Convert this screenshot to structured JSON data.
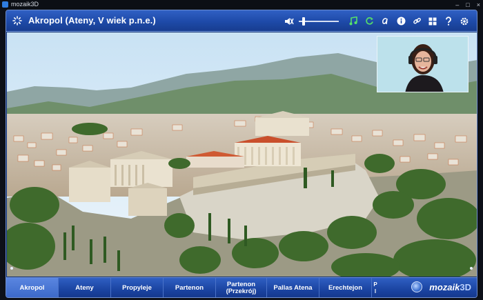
{
  "window": {
    "app_title": "mozaik3D",
    "controls": [
      "–",
      "□",
      "×"
    ]
  },
  "header": {
    "title": "Akropol (Ateny, V wiek p.n.e.)",
    "volume_level": 0.1,
    "tools": [
      {
        "name": "mute-speaker-icon",
        "glyph": "🔇"
      },
      {
        "name": "music-note-icon",
        "glyph": "♫"
      },
      {
        "name": "refresh-icon",
        "glyph": "⟳"
      },
      {
        "name": "text-script-icon",
        "glyph": "𝒶"
      },
      {
        "name": "info-icon",
        "glyph": "ℹ"
      },
      {
        "name": "link-icon",
        "glyph": "🔗"
      },
      {
        "name": "grid-icon",
        "glyph": "▦"
      },
      {
        "name": "help-icon",
        "glyph": "?"
      },
      {
        "name": "settings-gear-icon",
        "glyph": "⚙"
      }
    ]
  },
  "nav": {
    "items": [
      {
        "label": "Akropol",
        "active": true
      },
      {
        "label": "Ateny",
        "active": false
      },
      {
        "label": "Propyleje",
        "active": false
      },
      {
        "label": "Partenon",
        "active": false
      },
      {
        "label": "Partenon\n(Przekrój)",
        "active": false
      },
      {
        "label": "Pallas Atena",
        "active": false
      },
      {
        "label": "Erechtejon",
        "active": false
      }
    ],
    "more_label": "P\nl",
    "brand_text": "mozaik",
    "brand_suffix": "3D"
  },
  "colors": {
    "frame_blue": "#1e4aa8",
    "music_green": "#57e06a",
    "refresh_green": "#55d86b"
  }
}
